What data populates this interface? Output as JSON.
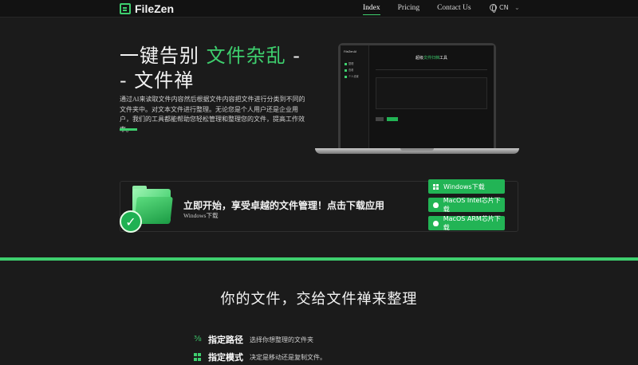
{
  "nav": {
    "logo": "FileZen",
    "links": [
      "Index",
      "Pricing",
      "Contact Us"
    ],
    "lang": "CN",
    "chevron": "⌄"
  },
  "hero": {
    "title_pre": "一键告别",
    "title_accent": "文件杂乱",
    "title_post": "- - 文件禅",
    "description": "通过AI来读取文件内容然后根据文件内容把文件进行分类到不同的文件夹中。对文本文件进行整理。无论您是个人用户还是企业用户，我们的工具都能帮助您轻松管理和整理您的文件，提高工作效率。"
  },
  "app_preview": {
    "logo": "FileZenAI",
    "nav_items": [
      "整理",
      "查看",
      "个人设置"
    ],
    "heading_pre": "超级",
    "heading_accent": "文件归档",
    "heading_post": "工具"
  },
  "cta": {
    "title": "立即开始，享受卓越的文件管理！点击下载应用",
    "subtitle": "Windows下载",
    "buttons": [
      {
        "label": "Windows下载",
        "icon": "windows-icon"
      },
      {
        "label": "MacOS Intel芯片下载",
        "icon": "apple-icon"
      },
      {
        "label": "MacOS ARM芯片下载",
        "icon": "apple-icon"
      }
    ],
    "check": "✓"
  },
  "section2": {
    "title": "你的文件，交给文件禅来整理",
    "features": [
      {
        "name": "指定路径",
        "desc": "选择你想整理的文件夹",
        "icon": "path-icon"
      },
      {
        "name": "指定模式",
        "desc": "决定是移动还是复制文件。",
        "icon": "grid-icon"
      }
    ]
  },
  "colors": {
    "accent": "#3ecf6e",
    "button": "#22b455",
    "background": "#1b1b1b"
  }
}
